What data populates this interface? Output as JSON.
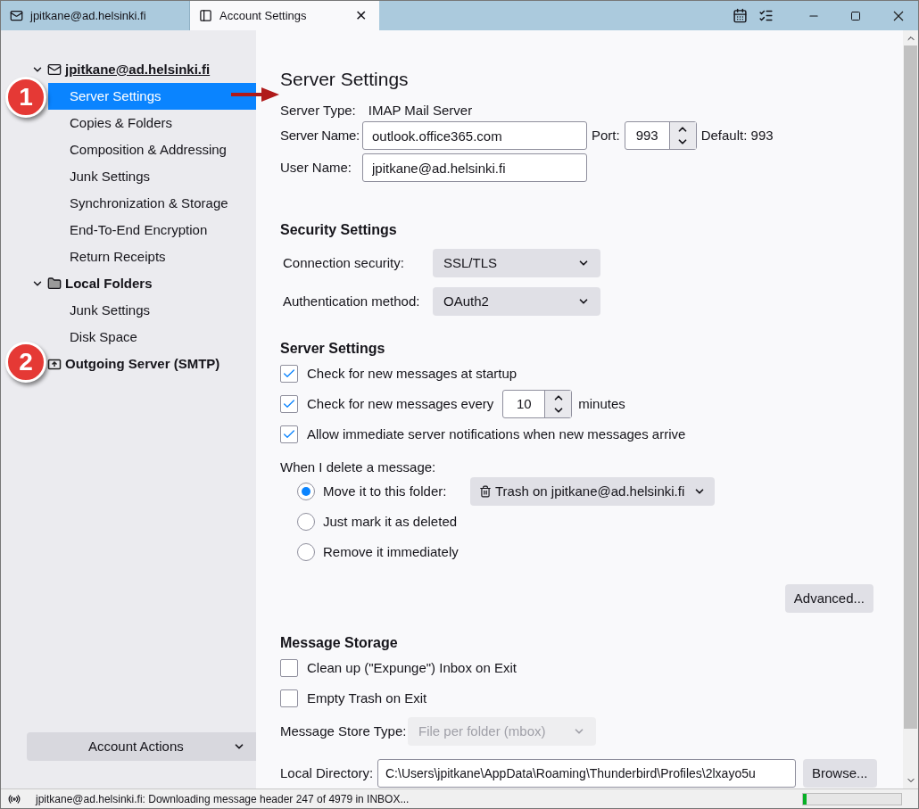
{
  "tabs": [
    {
      "label": "jpitkane@ad.helsinki.fi",
      "selected": false
    },
    {
      "label": "Account Settings",
      "selected": true
    }
  ],
  "close_symbol": "✕",
  "sidebar": {
    "items": [
      {
        "label": "jpitkane@ad.helsinki.fi",
        "expanded": true,
        "selected": false,
        "children": [
          {
            "label": "Server Settings",
            "selected": true
          },
          {
            "label": "Copies & Folders",
            "selected": false
          },
          {
            "label": "Composition & Addressing",
            "selected": false
          },
          {
            "label": "Junk Settings",
            "selected": false
          },
          {
            "label": "Synchronization & Storage",
            "selected": false
          },
          {
            "label": "End-To-End Encryption",
            "selected": false
          },
          {
            "label": "Return Receipts",
            "selected": false
          }
        ]
      },
      {
        "label": "Local Folders",
        "expanded": true,
        "selected": false,
        "children": [
          {
            "label": "Junk Settings",
            "selected": false
          },
          {
            "label": "Disk Space",
            "selected": false
          }
        ]
      },
      {
        "label": "Outgoing Server (SMTP)",
        "selected": false
      }
    ],
    "account_actions": "Account Actions"
  },
  "callouts": [
    "1",
    "2"
  ],
  "content": {
    "title": "Server Settings",
    "server_type": {
      "label": "Server Type:",
      "value": "IMAP Mail Server"
    },
    "server_name": {
      "label": "Server Name:",
      "value": "outlook.office365.com"
    },
    "port": {
      "label": "Port:",
      "value": "993",
      "default": "Default: 993"
    },
    "user_name": {
      "label": "User Name:",
      "value": "jpitkane@ad.helsinki.fi"
    },
    "security": {
      "heading": "Security Settings",
      "rows": [
        {
          "label": "Connection security:",
          "value": "SSL/TLS"
        },
        {
          "label": "Authentication method:",
          "value": "OAuth2"
        }
      ]
    },
    "server_settings": {
      "heading": "Server Settings",
      "checks": [
        {
          "kind": "plain",
          "label": "Check for new messages at startup",
          "checked": true
        },
        {
          "kind": "interval",
          "label": "Check for new messages every",
          "checked": true,
          "value": "10",
          "suffix": "minutes"
        },
        {
          "kind": "plain",
          "label": "Allow immediate server notifications when new messages arrive",
          "checked": true
        }
      ],
      "delete_label": "When I delete a message:",
      "radios": [
        {
          "label": "Move it to this folder:",
          "selected": true,
          "folder": "Trash on jpitkane@ad.helsinki.fi"
        },
        {
          "label": "Just mark it as deleted",
          "selected": false
        },
        {
          "label": "Remove it immediately",
          "selected": false
        }
      ],
      "advanced": "Advanced..."
    },
    "storage": {
      "heading": "Message Storage",
      "checks": [
        {
          "label": "Clean up (\"Expunge\") Inbox on Exit",
          "checked": false
        },
        {
          "label": "Empty Trash on Exit",
          "checked": false
        }
      ],
      "store_type": {
        "label": "Message Store Type:",
        "value": "File per folder (mbox)",
        "disabled": true
      },
      "local_directory": {
        "label": "Local Directory:",
        "value": "C:\\Users\\jpitkane\\AppData\\Roaming\\Thunderbird\\Profiles\\2lxayo5u",
        "button": "Browse..."
      }
    }
  },
  "status_bar": {
    "text": "jpitkane@ad.helsinki.fi: Downloading message header 247 of 4979 in INBOX...",
    "level": 0.04
  }
}
